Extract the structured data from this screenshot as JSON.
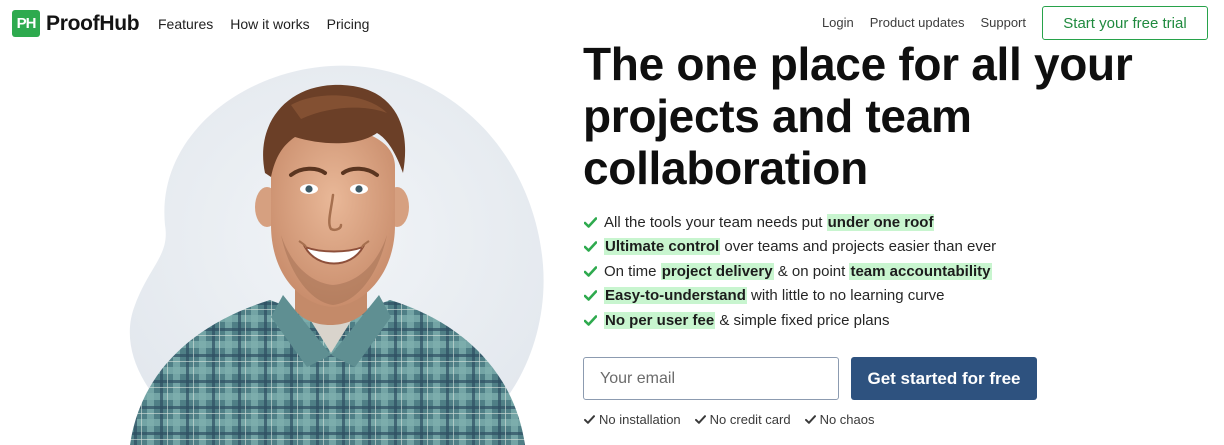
{
  "brand": {
    "logo_badge": "PH",
    "name": "ProofHub"
  },
  "nav_left": [
    {
      "label": "Features"
    },
    {
      "label": "How it works"
    },
    {
      "label": "Pricing"
    }
  ],
  "nav_right": [
    {
      "label": "Login"
    },
    {
      "label": "Product updates"
    },
    {
      "label": "Support"
    }
  ],
  "trial_button": "Start your free trial",
  "headline": "The one place for all your projects and team collaboration",
  "features": [
    {
      "pre": "All the tools your team needs put ",
      "hl1": "under one roof",
      "mid": "",
      "hl2": "",
      "post": ""
    },
    {
      "pre": "",
      "hl1": "Ultimate control",
      "mid": " over teams and projects easier than ever",
      "hl2": "",
      "post": ""
    },
    {
      "pre": "On time ",
      "hl1": "project delivery",
      "mid": " & on point ",
      "hl2": "team accountability",
      "post": ""
    },
    {
      "pre": "",
      "hl1": "Easy-to-understand",
      "mid": " with little to no learning curve",
      "hl2": "",
      "post": ""
    },
    {
      "pre": "",
      "hl1": "No per user fee",
      "mid": " & simple fixed price plans",
      "hl2": "",
      "post": ""
    }
  ],
  "signup": {
    "email_placeholder": "Your email",
    "email_value": "",
    "cta_label": "Get started for free"
  },
  "perks": [
    {
      "label": "No installation"
    },
    {
      "label": "No credit card"
    },
    {
      "label": "No chaos"
    }
  ],
  "colors": {
    "brand_green": "#2eaa4e",
    "cta_blue": "#2e527f",
    "highlight": "#c8f5cf",
    "check_green": "#2eaa4e"
  },
  "icons": {
    "feature_bullet": "check-icon",
    "perk_bullet": "check-icon"
  }
}
